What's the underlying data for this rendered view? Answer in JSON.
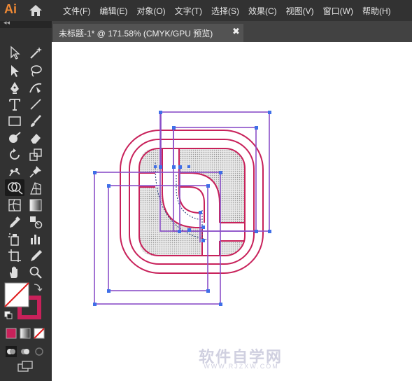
{
  "app": {
    "logo": "Ai"
  },
  "menu": [
    "文件(F)",
    "编辑(E)",
    "对象(O)",
    "文字(T)",
    "选择(S)",
    "效果(C)",
    "视图(V)",
    "窗口(W)",
    "帮助(H)"
  ],
  "document_tab": {
    "title": "未标题-1* @ 171.58% (CMYK/GPU 预览)",
    "close": "✖"
  },
  "toolbox": {
    "collapse": "◂◂"
  },
  "watermark": {
    "text": "软件自学网",
    "sub": "WWW.RJZXW.COM"
  },
  "colors": {
    "stroke_crimson": "#c8215a",
    "path_purple": "#8a4fc8",
    "anchor_blue": "#3f6fe8",
    "accent_orange": "#f08a35"
  }
}
